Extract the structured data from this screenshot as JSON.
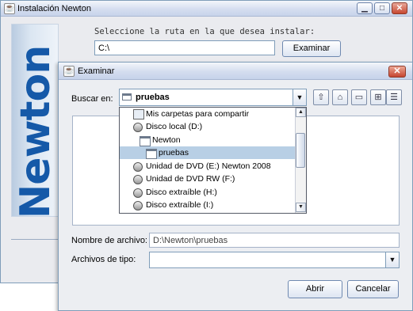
{
  "main_window": {
    "title": "Instalación Newton",
    "app_icon": "java-cup-icon",
    "controls": [
      "minimize-icon",
      "maximize-icon",
      "close-icon"
    ],
    "banner_text": "Newton",
    "prompt": "Seleccione la ruta en la que desea instalar:",
    "path_value": "C:\\",
    "browse_label": "Examinar"
  },
  "dialog": {
    "title": "Examinar",
    "close_glyph": "✕",
    "look_in_label": "Buscar en:",
    "look_in_value": "pruebas",
    "toolbar_icons": [
      "up-folder-icon",
      "home-icon",
      "new-folder-icon",
      "list-view-icon",
      "details-view-icon"
    ],
    "dropdown_items": [
      {
        "label": "Mis carpetas para compartir",
        "icon": "network-drive-icon",
        "selected": false
      },
      {
        "label": "Disco local (D:)",
        "icon": "disk-icon",
        "selected": false
      },
      {
        "label": "Newton",
        "icon": "folder-icon",
        "selected": false
      },
      {
        "label": "pruebas",
        "icon": "folder-icon",
        "selected": true
      },
      {
        "label": "Unidad de DVD (E:) Newton 2008",
        "icon": "disk-icon",
        "selected": false
      },
      {
        "label": "Unidad de DVD RW (F:)",
        "icon": "disk-icon",
        "selected": false
      },
      {
        "label": "Disco extraíble (H:)",
        "icon": "disk-icon",
        "selected": false
      },
      {
        "label": "Disco extraíble (I:)",
        "icon": "disk-icon",
        "selected": false
      }
    ],
    "file_name_label": "Nombre de archivo:",
    "file_name_value": "D:\\Newton\\pruebas",
    "file_type_label": "Archivos de tipo:",
    "file_type_value": "",
    "open_label": "Abrir",
    "cancel_label": "Cancelar"
  }
}
